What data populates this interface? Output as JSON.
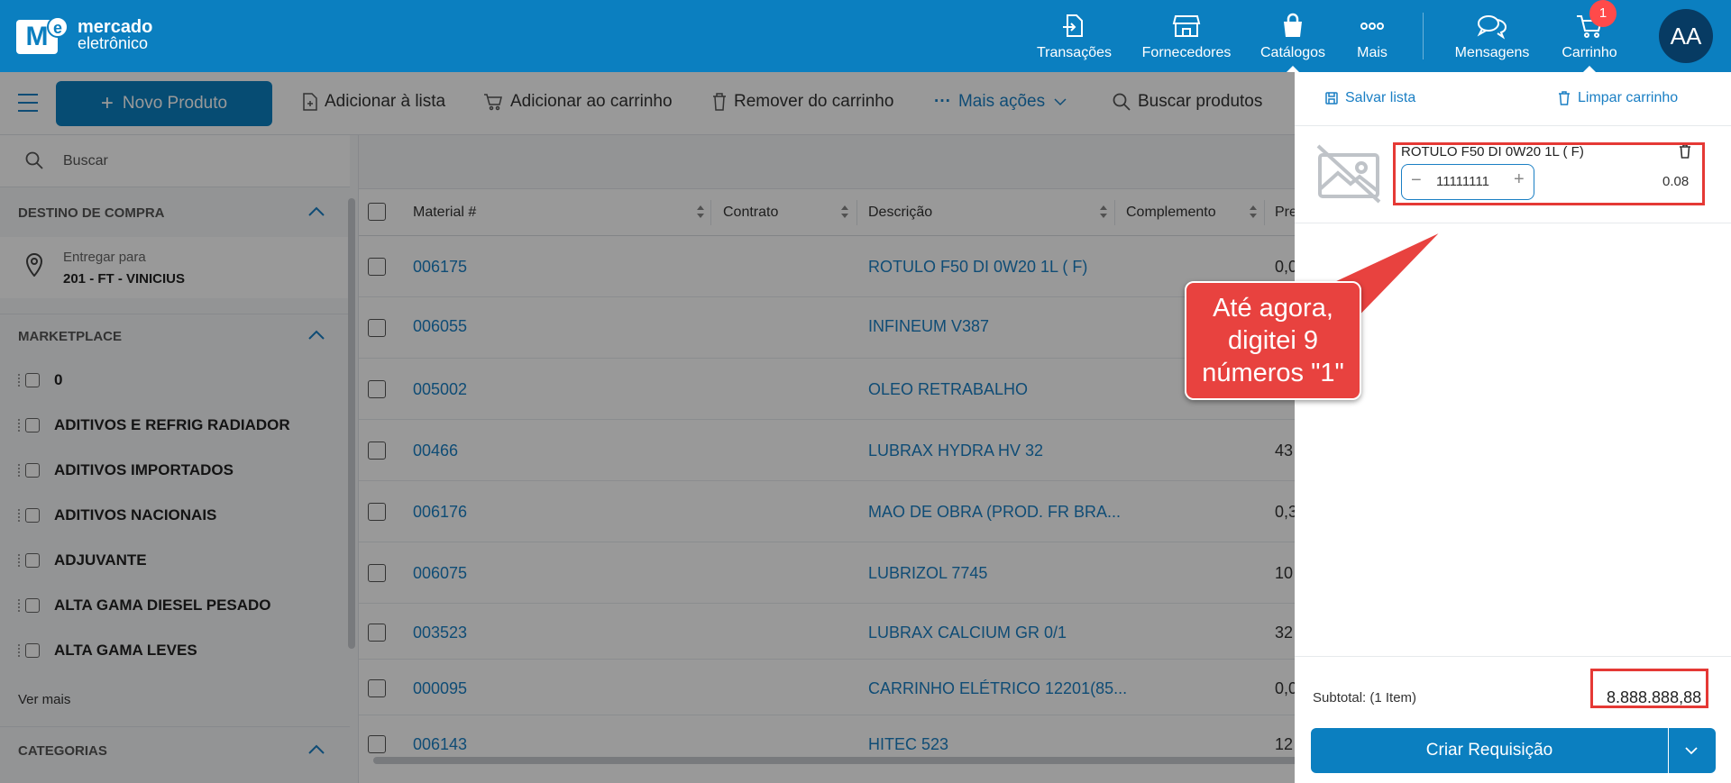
{
  "brand": {
    "line1": "mercado",
    "line2": "eletrônico"
  },
  "nav": {
    "transacoes": "Transações",
    "fornecedores": "Fornecedores",
    "catalogos": "Catálogos",
    "mais": "Mais",
    "mensagens": "Mensagens",
    "carrinho": "Carrinho",
    "cart_count": "1",
    "avatar": "AA"
  },
  "toolbar": {
    "novo_produto": "Novo Produto",
    "adicionar_lista": "Adicionar à lista",
    "adicionar_carrinho": "Adicionar ao carrinho",
    "remover_carrinho": "Remover do carrinho",
    "mais_acoes": "Mais ações",
    "buscar_produtos": "Buscar produtos"
  },
  "sidebar": {
    "search_placeholder": "Buscar",
    "destino_title": "DESTINO DE COMPRA",
    "entregar_para": "Entregar para",
    "entregar_valor": "201 - FT - VINICIUS",
    "marketplace_title": "MARKETPLACE",
    "marketplace_items": [
      "0",
      "ADITIVOS E REFRIG RADIADOR",
      "ADITIVOS IMPORTADOS",
      "ADITIVOS NACIONAIS",
      "ADJUVANTE",
      "ALTA GAMA DIESEL PESADO",
      "ALTA GAMA LEVES"
    ],
    "ver_mais": "Ver mais",
    "categorias_title": "CATEGORIAS"
  },
  "table": {
    "headers": {
      "material": "Material #",
      "contrato": "Contrato",
      "descricao": "Descrição",
      "complemento": "Complemento",
      "preco": "Pre"
    },
    "rows": [
      {
        "material": "006175",
        "descricao": "ROTULO F50 DI 0W20 1L ( F)",
        "preco": "0,0"
      },
      {
        "material": "006055",
        "descricao": "INFINEUM V387",
        "preco": ""
      },
      {
        "material": "005002",
        "descricao": "OLEO RETRABALHO",
        "preco": ""
      },
      {
        "material": "00466",
        "descricao": "LUBRAX HYDRA HV 32",
        "preco": "43"
      },
      {
        "material": "006176",
        "descricao": "MAO DE OBRA (PROD. FR BRA...",
        "preco": "0,3"
      },
      {
        "material": "006075",
        "descricao": "LUBRIZOL 7745",
        "preco": "10"
      },
      {
        "material": "003523",
        "descricao": "LUBRAX CALCIUM GR 0/1",
        "preco": "32"
      },
      {
        "material": "000095",
        "descricao": "CARRINHO ELÉTRICO 12201(85...",
        "preco": "0,0"
      },
      {
        "material": "006143",
        "descricao": "HITEC 523",
        "preco": "12"
      }
    ]
  },
  "cart": {
    "salvar_lista": "Salvar lista",
    "limpar_carrinho": "Limpar carrinho",
    "item_name": "ROTULO F50 DI 0W20 1L ( F)",
    "item_qty": "11111111",
    "item_price": "0.08",
    "subtotal_label": "Subtotal: (1 Item)",
    "subtotal_value": "8.888.888,88",
    "criar_requisicao": "Criar Requisição"
  },
  "annotation": {
    "line1": "Até agora,",
    "line2": "digitei 9",
    "line3": "números \"1\"",
    "color": "#e8423f"
  }
}
